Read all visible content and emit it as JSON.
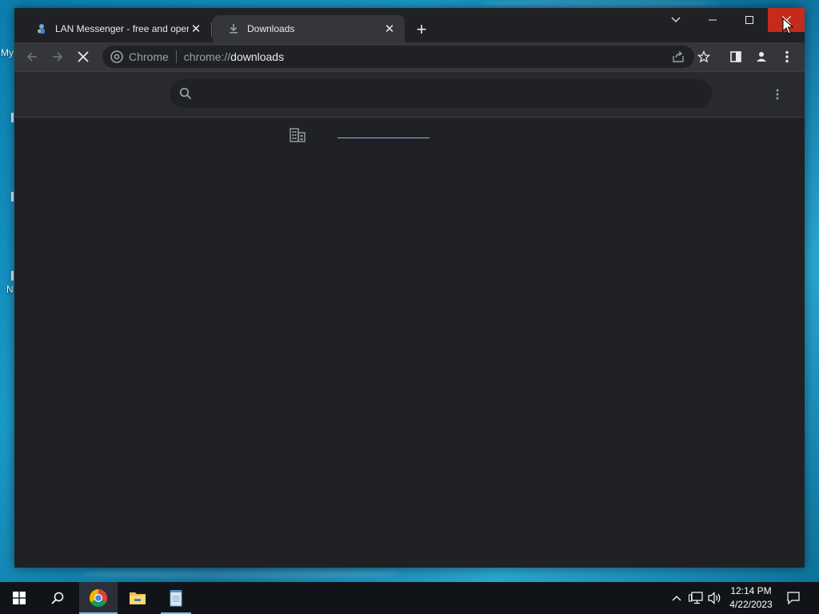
{
  "desktop": {
    "icon_labels": [
      "My",
      "N"
    ]
  },
  "browser": {
    "tabs": [
      {
        "title": "LAN Messenger - free and open",
        "favicon": "lan-messenger-icon",
        "active": false
      },
      {
        "title": "Downloads",
        "favicon": "download-icon",
        "active": true
      }
    ],
    "new_tab_label": "+",
    "window_controls": [
      "tab-search-icon",
      "minimize-icon",
      "maximize-icon",
      "close-icon"
    ],
    "omnibox": {
      "chip": "Chrome",
      "url_scheme": "chrome://",
      "url_host": "downloads"
    },
    "toolbar_icons": [
      "share-icon",
      "bookmark-star-icon",
      "side-panel-icon",
      "profile-icon",
      "menu-icon"
    ],
    "page": {
      "search_placeholder": "",
      "managed_icon": "building-icon"
    }
  },
  "taskbar": {
    "apps": [
      "start-icon",
      "search-icon",
      "chrome-icon",
      "file-explorer-icon",
      "notepad-icon"
    ],
    "clock": {
      "time": "12:14 PM",
      "date": "4/22/2023"
    }
  },
  "colors": {
    "window_bg": "#202124",
    "toolbar_bg": "#35363a",
    "close_hover": "#c42b1c",
    "link_accent": "#8ab4f8",
    "taskbar_bg": "#101418"
  }
}
